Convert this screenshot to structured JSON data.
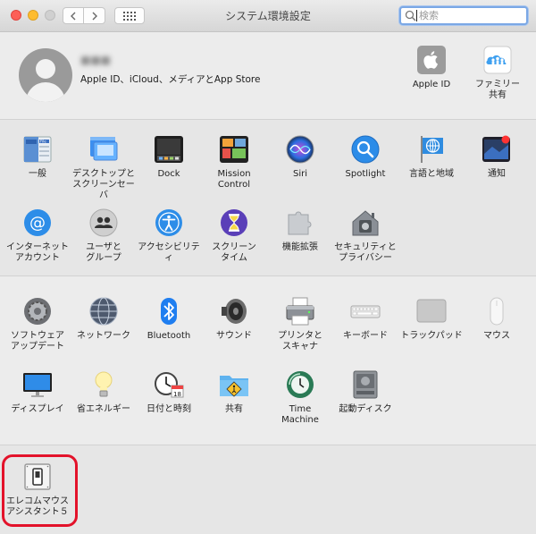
{
  "window": {
    "title": "システム環境設定",
    "search_placeholder": "検索"
  },
  "account": {
    "name": "■■■",
    "subtitle": "Apple ID、iCloud、メディアとApp Store",
    "panes": [
      {
        "label": "Apple ID",
        "icon": "apple-icon"
      },
      {
        "label": "ファミリー\n共有",
        "icon": "family-sharing-icon"
      }
    ]
  },
  "personal": [
    {
      "label": "一般",
      "icon": "general-icon"
    },
    {
      "label": "デスクトップと\nスクリーンセーバ",
      "icon": "desktop-icon"
    },
    {
      "label": "Dock",
      "icon": "dock-icon"
    },
    {
      "label": "Mission\nControl",
      "icon": "mission-control-icon"
    },
    {
      "label": "Siri",
      "icon": "siri-icon"
    },
    {
      "label": "Spotlight",
      "icon": "spotlight-icon"
    },
    {
      "label": "言語と地域",
      "icon": "globe-flag-icon"
    },
    {
      "label": "通知",
      "icon": "notifications-icon"
    },
    {
      "label": "インターネット\nアカウント",
      "icon": "at-sign-icon"
    },
    {
      "label": "ユーザと\nグループ",
      "icon": "users-icon"
    },
    {
      "label": "アクセシビリティ",
      "icon": "accessibility-icon"
    },
    {
      "label": "スクリーン\nタイム",
      "icon": "hourglass-icon"
    },
    {
      "label": "機能拡張",
      "icon": "puzzle-icon"
    },
    {
      "label": "セキュリティと\nプライバシー",
      "icon": "security-house-icon"
    }
  ],
  "hardware": [
    {
      "label": "ソフトウェア\nアップデート",
      "icon": "gear-icon"
    },
    {
      "label": "ネットワーク",
      "icon": "network-globe-icon"
    },
    {
      "label": "Bluetooth",
      "icon": "bluetooth-icon"
    },
    {
      "label": "サウンド",
      "icon": "speaker-icon"
    },
    {
      "label": "プリンタと\nスキャナ",
      "icon": "printer-icon"
    },
    {
      "label": "キーボード",
      "icon": "keyboard-icon"
    },
    {
      "label": "トラックパッド",
      "icon": "trackpad-icon"
    },
    {
      "label": "マウス",
      "icon": "mouse-icon"
    },
    {
      "label": "ディスプレイ",
      "icon": "display-icon"
    },
    {
      "label": "省エネルギー",
      "icon": "lightbulb-icon"
    },
    {
      "label": "日付と時刻",
      "icon": "clock-calendar-icon"
    },
    {
      "label": "共有",
      "icon": "shared-folder-icon"
    },
    {
      "label": "Time\nMachine",
      "icon": "time-machine-icon"
    },
    {
      "label": "起動ディスク",
      "icon": "disk-icon"
    }
  ],
  "calendar_day": "18",
  "other": [
    {
      "label": "エレコムマウス\nアシスタント５",
      "icon": "elecom-switch-icon"
    }
  ],
  "colors": {
    "highlight": "#e3122a",
    "search_focus": "#7ba8e5"
  }
}
